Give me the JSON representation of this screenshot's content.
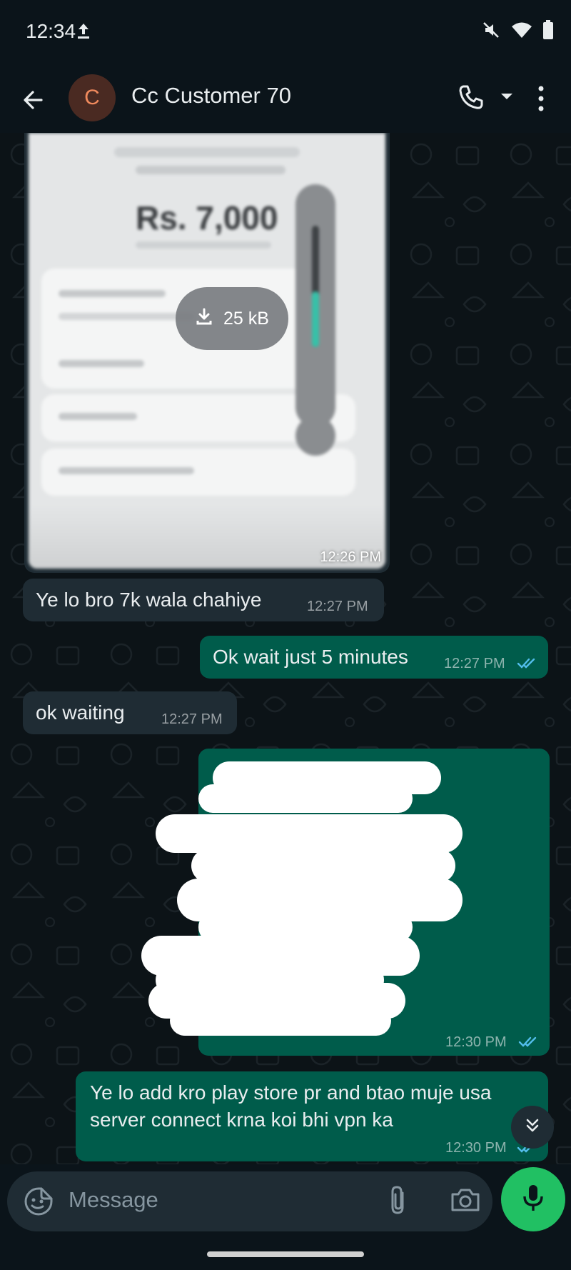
{
  "status": {
    "time": "12:34"
  },
  "header": {
    "avatar_letter": "C",
    "contact_name": "Cc Customer 70"
  },
  "messages": [
    {
      "type": "image",
      "direction": "incoming",
      "preview_amount": "Rs. 7,000",
      "download_size": "25 kB",
      "time": "12:26 PM"
    },
    {
      "type": "text",
      "direction": "incoming",
      "text": "Ye lo bro 7k wala chahiye",
      "time": "12:27 PM"
    },
    {
      "type": "text",
      "direction": "outgoing",
      "text": "Ok wait just 5 minutes",
      "time": "12:27 PM",
      "status": "read"
    },
    {
      "type": "text",
      "direction": "incoming",
      "text": "ok waiting",
      "time": "12:27 PM"
    },
    {
      "type": "redacted",
      "direction": "outgoing",
      "time": "12:30 PM",
      "status": "read"
    },
    {
      "type": "text",
      "direction": "outgoing",
      "lines": [
        "Ye lo add kro play store pr and btao muje usa",
        "server connect krna koi bhi vpn ka"
      ],
      "time": "12:30 PM",
      "status": "read"
    }
  ],
  "composer": {
    "placeholder": "Message"
  },
  "colors": {
    "incoming_bubble": "#1f2c34",
    "outgoing_bubble": "#005c4b",
    "accent": "#21c063",
    "read_ticks": "#53bdeb"
  },
  "icons": [
    "upload-icon",
    "mute-icon",
    "wifi-icon",
    "battery-icon",
    "back-arrow-icon",
    "phone-icon",
    "dropdown-icon",
    "more-icon",
    "download-icon",
    "scroll-down-icon",
    "sticker-icon",
    "attach-icon",
    "camera-icon",
    "mic-icon"
  ]
}
